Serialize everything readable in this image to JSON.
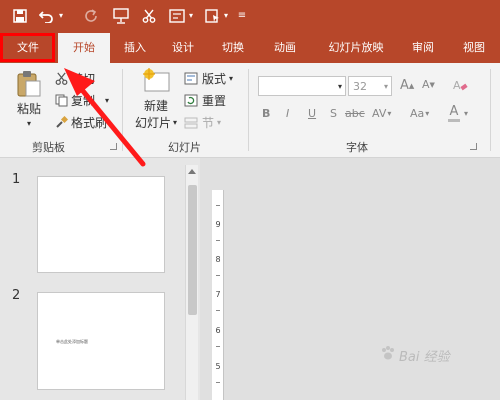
{
  "tabs": [
    {
      "label": "文件"
    },
    {
      "label": "开始"
    },
    {
      "label": "插入"
    },
    {
      "label": "设计"
    },
    {
      "label": "切换"
    },
    {
      "label": "动画"
    },
    {
      "label": "幻灯片放映"
    },
    {
      "label": "审阅"
    },
    {
      "label": "视图"
    }
  ],
  "clipboard": {
    "group_label": "剪贴板",
    "paste_label": "粘贴",
    "cut_label": "剪切",
    "copy_label": "复制",
    "format_painter_label": "格式刷"
  },
  "slides_group": {
    "group_label": "幻灯片",
    "new_slide_label_line1": "新建",
    "new_slide_label_line2": "幻灯片",
    "layout_label": "版式",
    "reset_label": "重置",
    "section_label": "节"
  },
  "font_group": {
    "group_label": "字体",
    "font_name": "",
    "font_size": "32",
    "bold": "B",
    "italic": "I",
    "underline": "U",
    "shadow": "S",
    "strike": "abc",
    "spacing": "AV",
    "case": "Aa",
    "grow": "A",
    "shrink": "A",
    "color": "A"
  },
  "slides": [
    {
      "number": "1"
    },
    {
      "number": "2",
      "text": "单击此处添加标题"
    }
  ],
  "ruler": [
    "9",
    "8",
    "7",
    "6",
    "5"
  ],
  "watermark": "Bai 经验",
  "colors": {
    "accent": "#b7472a",
    "highlight": "#ff0000"
  }
}
